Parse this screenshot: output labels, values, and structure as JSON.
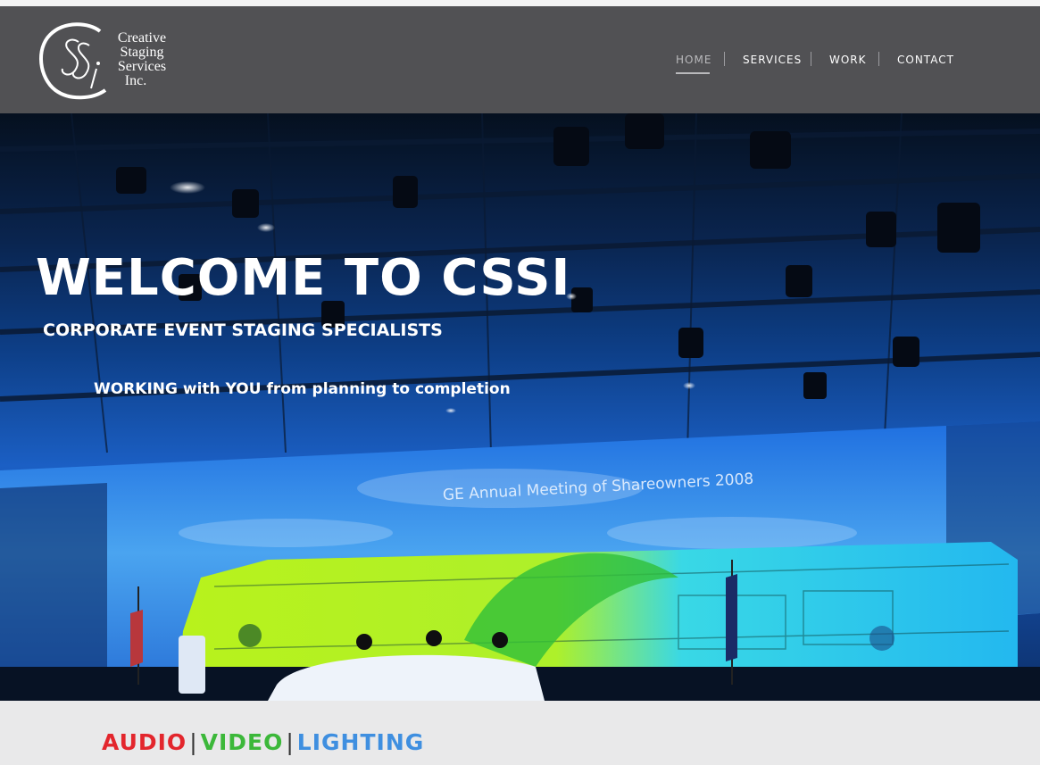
{
  "logo": {
    "line1": "Creative",
    "line2": "Staging",
    "line3": "Services",
    "line4": "Inc.",
    "monogram": "CSSi"
  },
  "nav": {
    "items": [
      {
        "label": "HOME",
        "active": true
      },
      {
        "label": "SERVICES",
        "active": false
      },
      {
        "label": "WORK",
        "active": false
      },
      {
        "label": "CONTACT",
        "active": false
      }
    ]
  },
  "hero": {
    "title": "WELCOME TO CSSI",
    "subtitle": "CORPORATE EVENT STAGING SPECIALISTS",
    "tagline": "WORKING with YOU from planning to completion",
    "screen_caption": "GE Annual Meeting of Shareowners 2008"
  },
  "services": {
    "audio": "AUDIO",
    "video": "VIDEO",
    "lighting": "LIGHTING",
    "separator": "|",
    "colors": {
      "audio": "#e3262d",
      "video": "#3cb83a",
      "lighting": "#3f8fe0"
    }
  },
  "colors": {
    "header_bg": "#515154",
    "nav_active": "#b9b9bc",
    "band_bg": "#e9e9ea"
  }
}
